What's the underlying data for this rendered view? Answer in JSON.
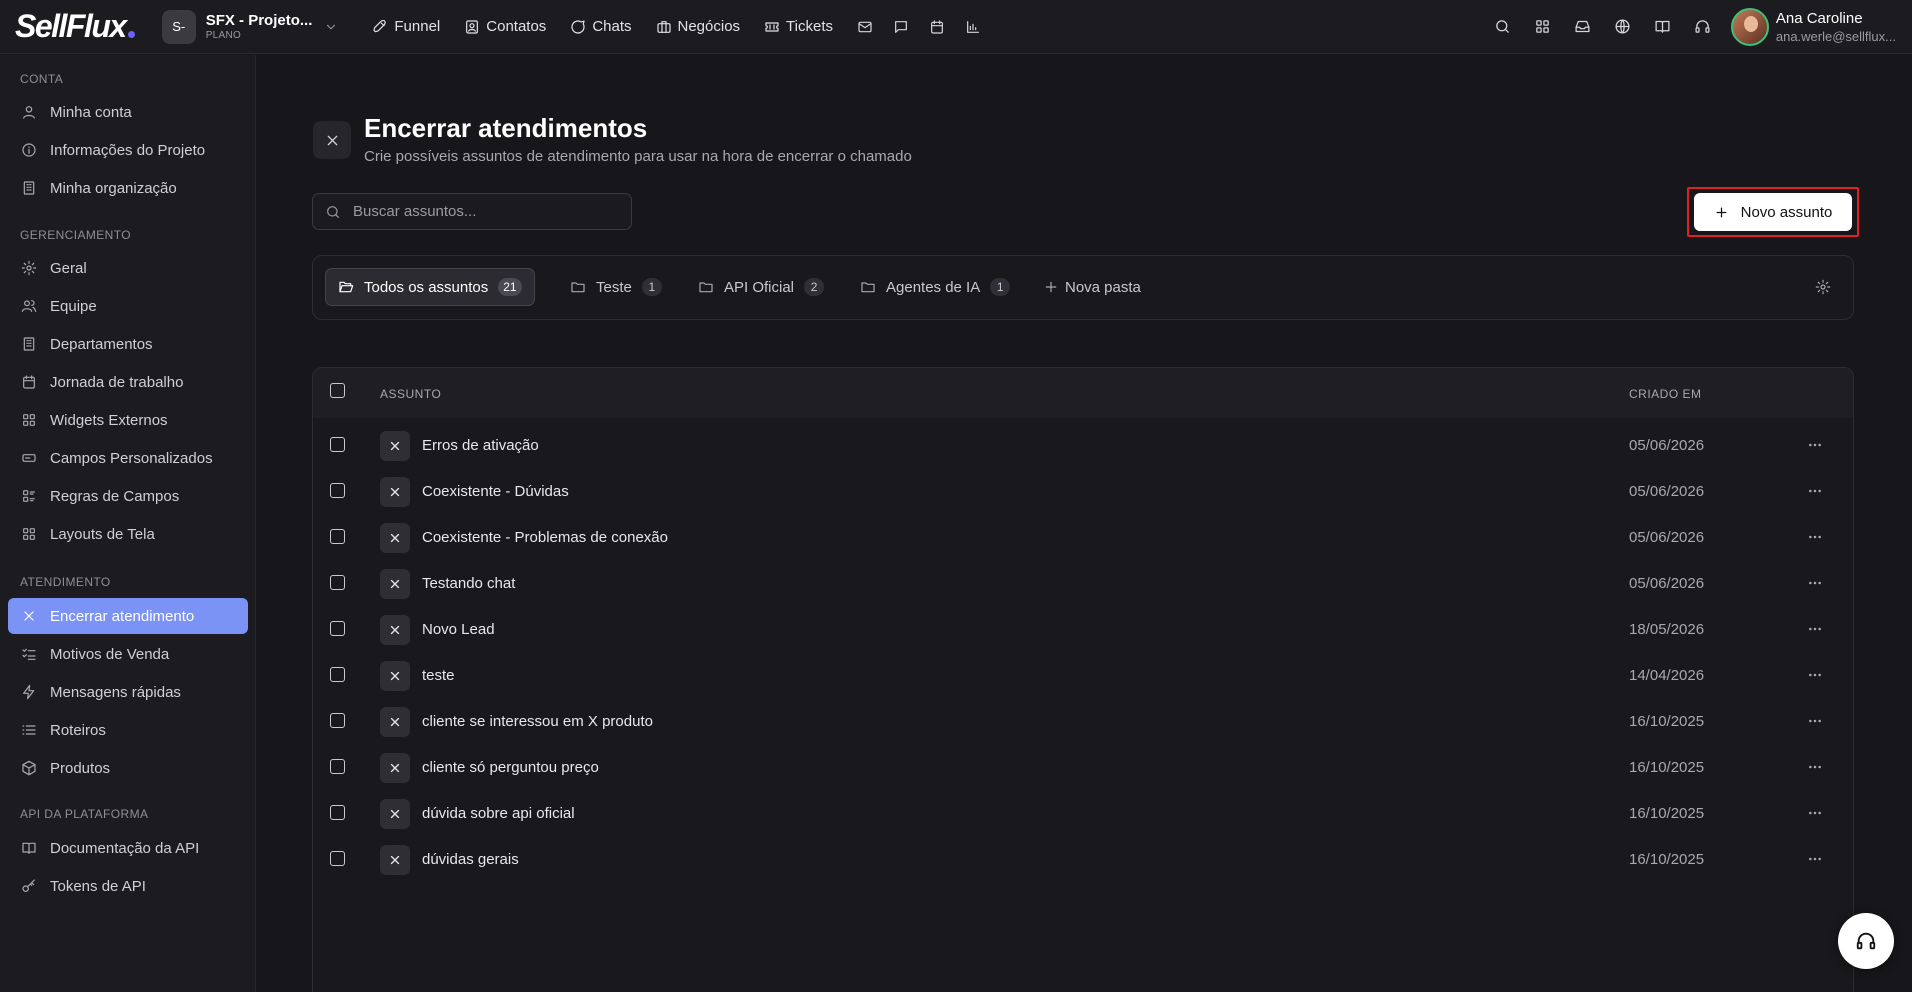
{
  "brand": {
    "logo_text": "SellFlux",
    "accent": "#6c63ff"
  },
  "project": {
    "avatar": "S-",
    "name": "SFX - Projeto...",
    "plan": "PLANO"
  },
  "nav": [
    {
      "label": "Funnel",
      "icon": "rocket-icon"
    },
    {
      "label": "Contatos",
      "icon": "contacts-icon"
    },
    {
      "label": "Chats",
      "icon": "chat-icon"
    },
    {
      "label": "Negócios",
      "icon": "briefcase-icon"
    },
    {
      "label": "Tickets",
      "icon": "ticket-icon"
    }
  ],
  "nav_icons": [
    "mail-icon",
    "message-square-icon",
    "calendar-icon",
    "bar-chart-icon"
  ],
  "top_icons": [
    "search-icon",
    "apps-grid-icon",
    "inbox-icon",
    "globe-icon",
    "book-icon",
    "headset-icon"
  ],
  "user": {
    "name": "Ana Caroline",
    "email": "ana.werle@sellflux..."
  },
  "sidebar": {
    "sections": [
      {
        "title": "CONTA",
        "items": [
          {
            "label": "Minha conta",
            "icon": "user-icon"
          },
          {
            "label": "Informações do Projeto",
            "icon": "info-icon"
          },
          {
            "label": "Minha organização",
            "icon": "building-icon"
          }
        ]
      },
      {
        "title": "GERENCIAMENTO",
        "items": [
          {
            "label": "Geral",
            "icon": "gear-icon"
          },
          {
            "label": "Equipe",
            "icon": "users-icon"
          },
          {
            "label": "Departamentos",
            "icon": "building-icon"
          },
          {
            "label": "Jornada de trabalho",
            "icon": "calendar-icon"
          },
          {
            "label": "Widgets Externos",
            "icon": "widgets-icon"
          },
          {
            "label": "Campos Personalizados",
            "icon": "input-icon"
          },
          {
            "label": "Regras de Campos",
            "icon": "rules-icon"
          },
          {
            "label": "Layouts de Tela",
            "icon": "layout-icon"
          }
        ]
      },
      {
        "title": "ATENDIMENTO",
        "items": [
          {
            "label": "Encerrar atendimento",
            "icon": "close-icon",
            "active": true
          },
          {
            "label": "Motivos de Venda",
            "icon": "checklist-icon"
          },
          {
            "label": "Mensagens rápidas",
            "icon": "bolt-icon"
          },
          {
            "label": "Roteiros",
            "icon": "list-icon"
          },
          {
            "label": "Produtos",
            "icon": "box-icon"
          }
        ]
      },
      {
        "title": "API DA PLATAFORMA",
        "items": [
          {
            "label": "Documentação da API",
            "icon": "book-icon"
          },
          {
            "label": "Tokens de API",
            "icon": "key-icon"
          }
        ]
      }
    ],
    "active_color": "#7b93f4"
  },
  "page": {
    "title": "Encerrar atendimentos",
    "subtitle": "Crie possíveis assuntos de atendimento para usar na hora de encerrar o chamado",
    "search_placeholder": "Buscar assuntos...",
    "new_button": "Novo assunto",
    "highlight_color": "#e02020"
  },
  "folders": [
    {
      "label": "Todos os assuntos",
      "count": "21",
      "active": true
    },
    {
      "label": "Teste",
      "count": "1"
    },
    {
      "label": "API Oficial",
      "count": "2"
    },
    {
      "label": "Agentes de IA",
      "count": "1"
    }
  ],
  "new_folder_label": "Nova pasta",
  "table": {
    "columns": {
      "subject": "ASSUNTO",
      "created": "CRIADO EM"
    },
    "rows": [
      {
        "name": "Erros de ativação",
        "date": "05/06/2026"
      },
      {
        "name": "Coexistente - Dúvidas",
        "date": "05/06/2026"
      },
      {
        "name": "Coexistente - Problemas de conexão",
        "date": "05/06/2026"
      },
      {
        "name": "Testando chat",
        "date": "05/06/2026"
      },
      {
        "name": "Novo Lead",
        "date": "18/05/2026"
      },
      {
        "name": "teste",
        "date": "14/04/2026"
      },
      {
        "name": "cliente se interessou em X produto",
        "date": "16/10/2025"
      },
      {
        "name": "cliente só perguntou preço",
        "date": "16/10/2025"
      },
      {
        "name": "dúvida sobre api oficial",
        "date": "16/10/2025"
      },
      {
        "name": "dúvidas gerais",
        "date": "16/10/2025"
      }
    ]
  }
}
